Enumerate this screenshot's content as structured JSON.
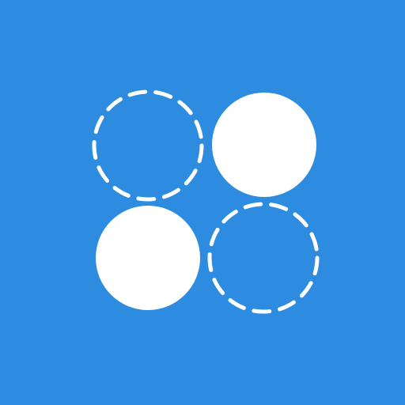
{
  "colors": {
    "background": "#2d8ce0",
    "foreground": "#ffffff"
  },
  "icon": {
    "name": "four-circle-grid-icon",
    "circles": [
      {
        "name": "top-left-circle",
        "style": "dashed-outline"
      },
      {
        "name": "top-right-circle",
        "style": "filled"
      },
      {
        "name": "bottom-left-circle",
        "style": "filled"
      },
      {
        "name": "bottom-right-circle",
        "style": "dashed-outline"
      }
    ]
  }
}
